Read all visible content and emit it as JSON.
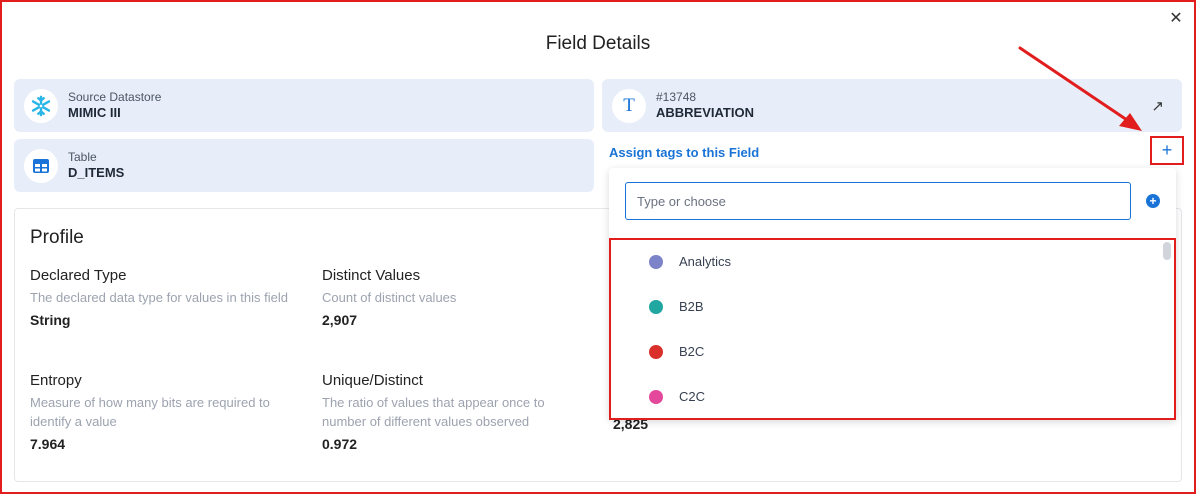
{
  "dialog": {
    "title": "Field Details",
    "close_glyph": "✕"
  },
  "cards": {
    "source": {
      "label": "Source Datastore",
      "value": "MIMIC III",
      "icon": "snowflake-icon"
    },
    "field": {
      "label": "#13748",
      "value": "ABBREVIATION",
      "icon_glyph": "T",
      "link_glyph": "↗"
    },
    "table": {
      "label": "Table",
      "value": "D_ITEMS",
      "icon": "table-icon"
    }
  },
  "tags": {
    "assign_label": "Assign tags to this Field",
    "plus_glyph": "+",
    "input_placeholder": "Type or choose",
    "add_glyph": "+",
    "items": [
      {
        "label": "Analytics",
        "color": "#7b83c9"
      },
      {
        "label": "B2B",
        "color": "#1fa7a0"
      },
      {
        "label": "B2C",
        "color": "#d9302b"
      },
      {
        "label": "C2C",
        "color": "#e4489a"
      }
    ]
  },
  "profile": {
    "heading": "Profile",
    "metrics": [
      {
        "name": "Declared Type",
        "desc": "The declared data type for values in this field",
        "value": "String"
      },
      {
        "name": "Distinct Values",
        "desc": "Count of distinct values",
        "value": "2,907"
      },
      {
        "name": "Entropy",
        "desc": "Measure of how many bits are required to identify a value",
        "value": "7.964"
      },
      {
        "name": "Unique/Distinct",
        "desc": "The ratio of values that appear once to number of different values observed",
        "value": "0.972"
      }
    ],
    "partial_value": "2,825"
  },
  "colors": {
    "accent": "#1a73d6",
    "highlight": "#e11d1d",
    "card_bg": "#e8eef9"
  }
}
